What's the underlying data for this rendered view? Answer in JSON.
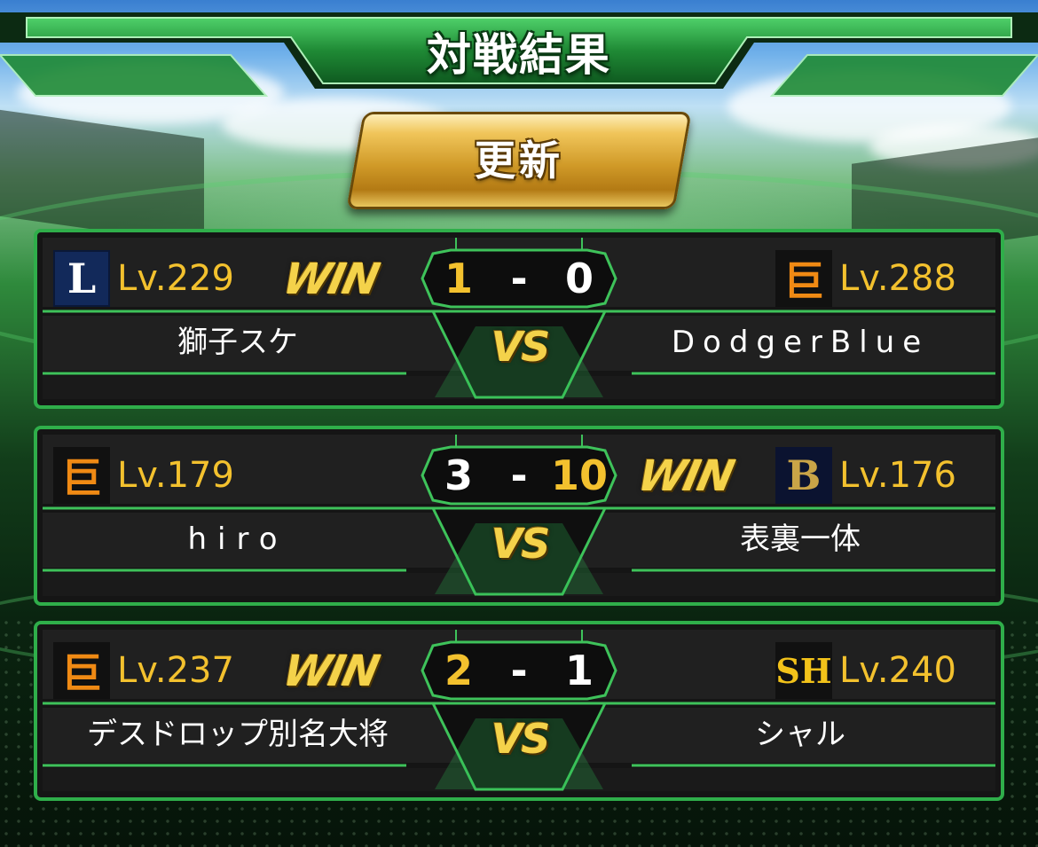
{
  "header": {
    "title": "対戦結果"
  },
  "refresh_button": {
    "label": "更新"
  },
  "matches": [
    {
      "left": {
        "team": "lions",
        "logo_glyph": "L",
        "level": "Lv.229",
        "name": "獅子スケ",
        "win": "WIN"
      },
      "score": {
        "left": "1",
        "dash": "-",
        "right": "0",
        "left_color": "#f3c12e",
        "right_color": "#ffffff"
      },
      "vs": "VS",
      "right": {
        "team": "giants",
        "logo_glyph": "巨",
        "level": "Lv.288",
        "name": "DodgerBlue",
        "win": ""
      }
    },
    {
      "left": {
        "team": "giants",
        "logo_glyph": "巨",
        "level": "Lv.179",
        "name": "hiro",
        "win": ""
      },
      "score": {
        "left": "3",
        "dash": "-",
        "right": "10",
        "left_color": "#ffffff",
        "right_color": "#f3c12e"
      },
      "vs": "VS",
      "right": {
        "team": "buffaloes",
        "logo_glyph": "B",
        "level": "Lv.176",
        "name": "表裏一体",
        "win": "WIN"
      }
    },
    {
      "left": {
        "team": "giants",
        "logo_glyph": "巨",
        "level": "Lv.237",
        "name": "デスドロップ別名大将",
        "win": "WIN"
      },
      "score": {
        "left": "2",
        "dash": "-",
        "right": "1",
        "left_color": "#f3c12e",
        "right_color": "#ffffff"
      },
      "vs": "VS",
      "right": {
        "team": "hawks",
        "logo_glyph": "SH",
        "level": "Lv.240",
        "name": "シャル",
        "win": ""
      }
    }
  ],
  "colors": {
    "accent_green": "#3ec25a",
    "frame_dark": "#1e1e1e",
    "gold": "#f3c12e"
  }
}
